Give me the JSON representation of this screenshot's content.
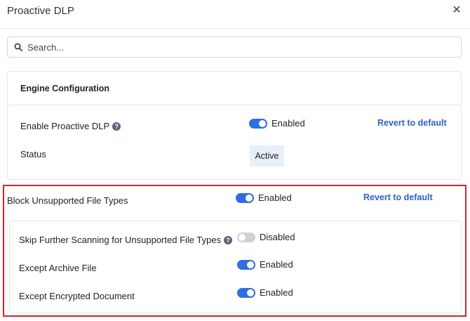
{
  "dialog": {
    "title": "Proactive DLP"
  },
  "search": {
    "placeholder": "Search..."
  },
  "engine_config": {
    "title": "Engine Configuration",
    "enable_label": "Enable Proactive DLP",
    "enable_state": "Enabled",
    "revert_label": "Revert to default",
    "status_label": "Status",
    "status_value": "Active"
  },
  "block_unsupported": {
    "label": "Block Unsupported File Types",
    "state": "Enabled",
    "revert_label": "Revert to default",
    "options": [
      {
        "label": "Skip Further Scanning for Unsupported File Types",
        "state": "Disabled",
        "on": false,
        "help": true
      },
      {
        "label": "Except Archive File",
        "state": "Enabled",
        "on": true,
        "help": false
      },
      {
        "label": "Except Encrypted Document",
        "state": "Enabled",
        "on": true,
        "help": false
      }
    ]
  },
  "icons": {
    "close": "close-icon",
    "search": "search-icon",
    "help": "help-icon"
  },
  "colors": {
    "accent": "#2f6fe0",
    "link": "#2f62c4",
    "highlight_border": "#d9232e",
    "badge_bg": "#e6effa"
  }
}
